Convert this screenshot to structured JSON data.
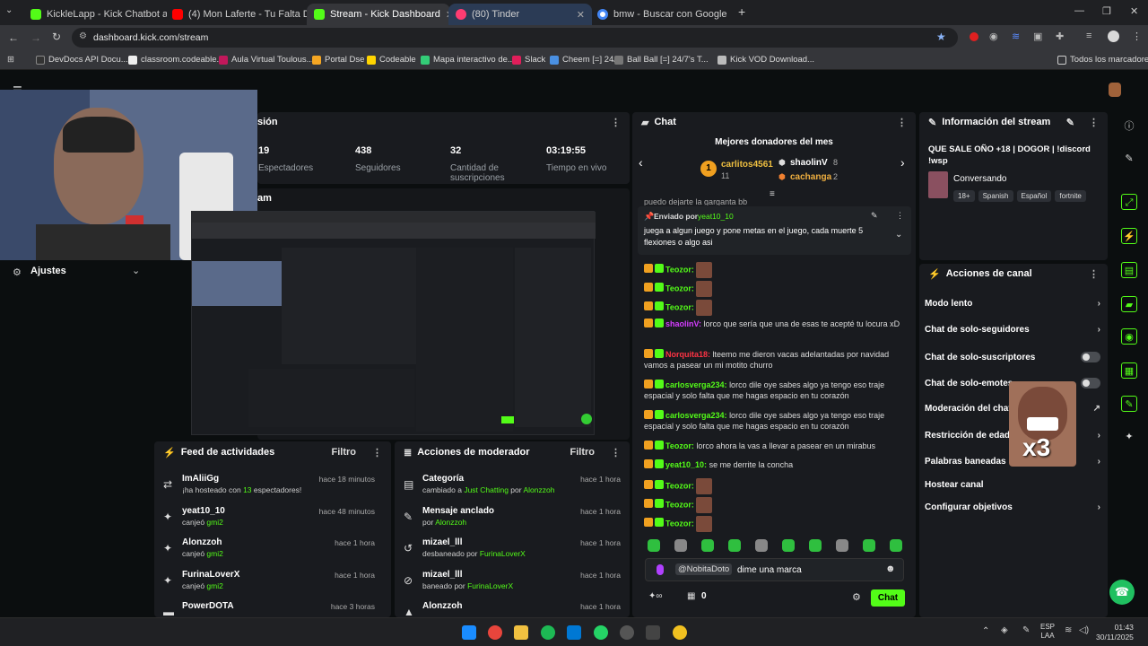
{
  "tabs": [
    {
      "title": "KickleLapp - Kick Chatbot and",
      "color": "#53fc18"
    },
    {
      "title": "(4) Mon Laferte - Tu Falta D",
      "color": "#ff0000"
    },
    {
      "title": "Stream - Kick Dashboard",
      "color": "#53fc18"
    },
    {
      "title": "(80) Tinder",
      "color": "#fe3c72"
    },
    {
      "title": "bmw - Buscar con Google",
      "color": "#4285f4"
    }
  ],
  "address": "dashboard.kick.com/stream",
  "bookmarks": [
    "DevDocs API Docu...",
    "classroom.codeable...",
    "Aula Virtual Toulous...",
    "Portal Dse",
    "Codeable",
    "Mapa interactivo de...",
    "Slack",
    "Cheem [=] 24/7",
    "Ball Ball [=] 24/7's T...",
    "Kick VOD Download..."
  ],
  "bookmarks_folder": "Todos los marcadores",
  "settings_label": "Ajustes",
  "stats_header": "sión",
  "stats": [
    {
      "value": "19",
      "label": "Espectadores"
    },
    {
      "value": "438",
      "label": "Seguidores"
    },
    {
      "value": "32",
      "label": "Cantidad de suscripciones"
    },
    {
      "value": "03:19:55",
      "label": "Tiempo en vivo"
    }
  ],
  "preview_header": "am",
  "feed": {
    "title": "Feed de actividades",
    "filter": "Filtro",
    "rows": [
      {
        "name": "ImAliiGg",
        "pre": "¡ha hosteado con ",
        "hl": "13",
        "post": " espectadores!",
        "time": "hace 18 minutos",
        "icon": "⇄"
      },
      {
        "name": "yeat10_10",
        "pre": "canjeó ",
        "hl": "gmi2",
        "post": "",
        "time": "hace 48 minutos",
        "icon": "✦"
      },
      {
        "name": "Alonzzoh",
        "pre": "canjeó ",
        "hl": "gmi2",
        "post": "",
        "time": "hace 1 hora",
        "icon": "✦"
      },
      {
        "name": "FurinaLoverX",
        "pre": "canjeó ",
        "hl": "gmi2",
        "post": "",
        "time": "hace 1 hora",
        "icon": "✦"
      },
      {
        "name": "PowerDOTA",
        "pre": "",
        "hl": "",
        "post": "",
        "time": "hace 3 horas",
        "icon": "▬"
      }
    ]
  },
  "mod": {
    "title": "Acciones de moderador",
    "filter": "Filtro",
    "rows": [
      {
        "name": "Categoría",
        "pre": "cambiado a ",
        "hl": "Just Chatting",
        "post": " por ",
        "hl2": "Alonzzoh",
        "time": "hace 1 hora",
        "icon": "▤"
      },
      {
        "name": "Mensaje anclado",
        "pre": "por ",
        "hl": "Alonzzoh",
        "post": "",
        "hl2": "",
        "time": "hace 1 hora",
        "icon": "✎"
      },
      {
        "name": "mizael_lll",
        "pre": "desbaneado por ",
        "hl": "FurinaLoverX",
        "post": "",
        "hl2": "",
        "time": "hace 1 hora",
        "icon": "↺"
      },
      {
        "name": "mizael_lll",
        "pre": "baneado por ",
        "hl": "FurinaLoverX",
        "post": "",
        "hl2": "",
        "time": "hace 1 hora",
        "icon": "⊘"
      },
      {
        "name": "Alonzzoh",
        "pre": "",
        "hl": "",
        "post": "",
        "hl2": "",
        "time": "hace 1 hora",
        "icon": "▲"
      }
    ]
  },
  "chat": {
    "title": "Chat",
    "donors_title": "Mejores donadores del mes",
    "donors": [
      {
        "rank": "1",
        "name": "carlitos4561",
        "amount": "11"
      },
      {
        "rank": "",
        "name": "shaolinV",
        "amount": "8"
      },
      {
        "rank": "",
        "name": "cachanga",
        "amount": "2"
      }
    ],
    "clipped_line": "puedo dejarte la garganta bb",
    "pinned_by_label": "Enviado por",
    "pinned_by": "yeat10_10",
    "pinned_text": "juega a algun juego y pone metas en el juego, cada muerte 5 flexiones o algo asi",
    "messages": [
      {
        "user": "Teozor:",
        "text": "",
        "color": "#53fc18",
        "emote": true
      },
      {
        "user": "Teozor:",
        "text": "",
        "color": "#53fc18",
        "emote": true
      },
      {
        "user": "Teozor:",
        "text": "",
        "color": "#53fc18",
        "emote": true
      },
      {
        "user": "shaolinV:",
        "text": "lorco que sería que una de esas te acepté tu locura xD",
        "color": "#d43cff",
        "emote": false
      },
      {
        "user": "Norquita18:",
        "text": "lteemo me dieron vacas adelantadas por navidad vamos a pasear un mi motito churro",
        "color": "#ff3344",
        "emote": false
      },
      {
        "user": "carlosverga234:",
        "text": "lorco dile oye sabes algo ya tengo eso traje espacial y solo falta que me hagas espacio en tu corazón",
        "color": "#53fc18",
        "emote": false
      },
      {
        "user": "carlosverga234:",
        "text": "lorco dile oye sabes algo ya tengo eso traje espacial y solo falta que me hagas espacio en tu corazón",
        "color": "#53fc18",
        "emote": false
      },
      {
        "user": "Teozor:",
        "text": "lorco ahora la vas a llevar a pasear en un mirabus",
        "color": "#53fc18",
        "emote": false
      },
      {
        "user": "yeat10_10:",
        "text": "se me derrite la concha",
        "color": "#53fc18",
        "emote": false
      },
      {
        "user": "Teozor:",
        "text": "",
        "color": "#53fc18",
        "emote": true
      },
      {
        "user": "Teozor:",
        "text": "",
        "color": "#53fc18",
        "emote": true
      },
      {
        "user": "Teozor:",
        "text": "",
        "color": "#53fc18",
        "emote": true
      }
    ],
    "reply_to": "@NobitaDoto",
    "input_value": "dime una marca",
    "footer_count": "0",
    "send_label": "Chat"
  },
  "info": {
    "title": "Información del stream",
    "stream_title": "QUE SALE OÑO +18 | DOGOR | !discord !wsp",
    "category": "Conversando",
    "tags": [
      "18+",
      "Spanish",
      "Español",
      "fortnite"
    ]
  },
  "actions": {
    "title": "Acciones de canal",
    "items": [
      {
        "label": "Modo lento",
        "kind": "chevron"
      },
      {
        "label": "Chat de solo-seguidores",
        "kind": "chevron"
      },
      {
        "label": "Chat de solo-suscriptores",
        "kind": "toggle"
      },
      {
        "label": "Chat de solo-emotes",
        "kind": "toggle"
      },
      {
        "label": "Moderación del chat",
        "kind": "ext"
      },
      {
        "label": "Restricción de edad",
        "kind": "chevron"
      },
      {
        "label": "Palabras baneadas",
        "kind": "chevron"
      },
      {
        "label": "Hostear canal",
        "kind": "none"
      },
      {
        "label": "Configurar objetivos",
        "kind": "chevron"
      }
    ],
    "overlay_text": "x3"
  },
  "taskbar": {
    "lang": "ESP",
    "lang2": "LAA",
    "time": "01:43",
    "date": "30/11/2025"
  }
}
